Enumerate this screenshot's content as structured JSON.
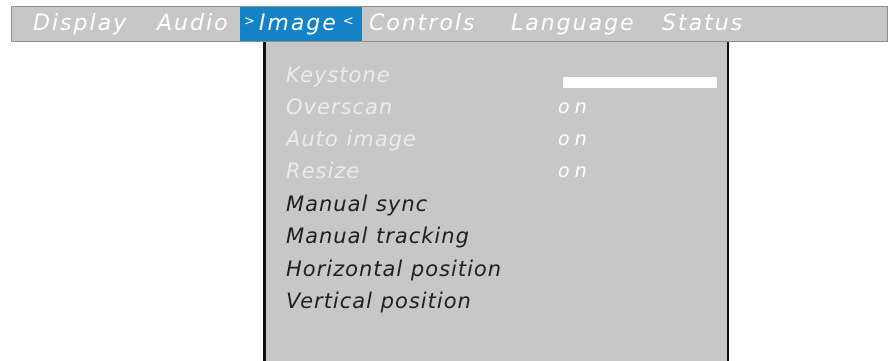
{
  "menubar": {
    "tabs": [
      {
        "label": "Display"
      },
      {
        "label": "Audio"
      },
      {
        "label": "Image",
        "arrow_right": ">",
        "arrow_left": "<"
      },
      {
        "label": "Controls"
      },
      {
        "label": "Language"
      },
      {
        "label": "Status"
      }
    ],
    "active_tab": "Image"
  },
  "image_menu": {
    "items": [
      {
        "label": "Keystone",
        "state": "disabled",
        "control": "slider"
      },
      {
        "label": "Overscan",
        "state": "disabled",
        "value": "on"
      },
      {
        "label": "Auto image",
        "state": "disabled",
        "value": "on"
      },
      {
        "label": "Resize",
        "state": "disabled",
        "value": "on"
      },
      {
        "label": "Manual sync",
        "state": "enabled"
      },
      {
        "label": "Manual tracking",
        "state": "enabled"
      },
      {
        "label": "Horizontal position",
        "state": "enabled"
      },
      {
        "label": "Vertical position",
        "state": "enabled"
      }
    ]
  },
  "colors": {
    "menu_bg": "#c7c7c7",
    "active_tab_bg": "#1383c8",
    "disabled_text": "#ebebeb",
    "enabled_text": "#202020",
    "border": "#111111"
  }
}
